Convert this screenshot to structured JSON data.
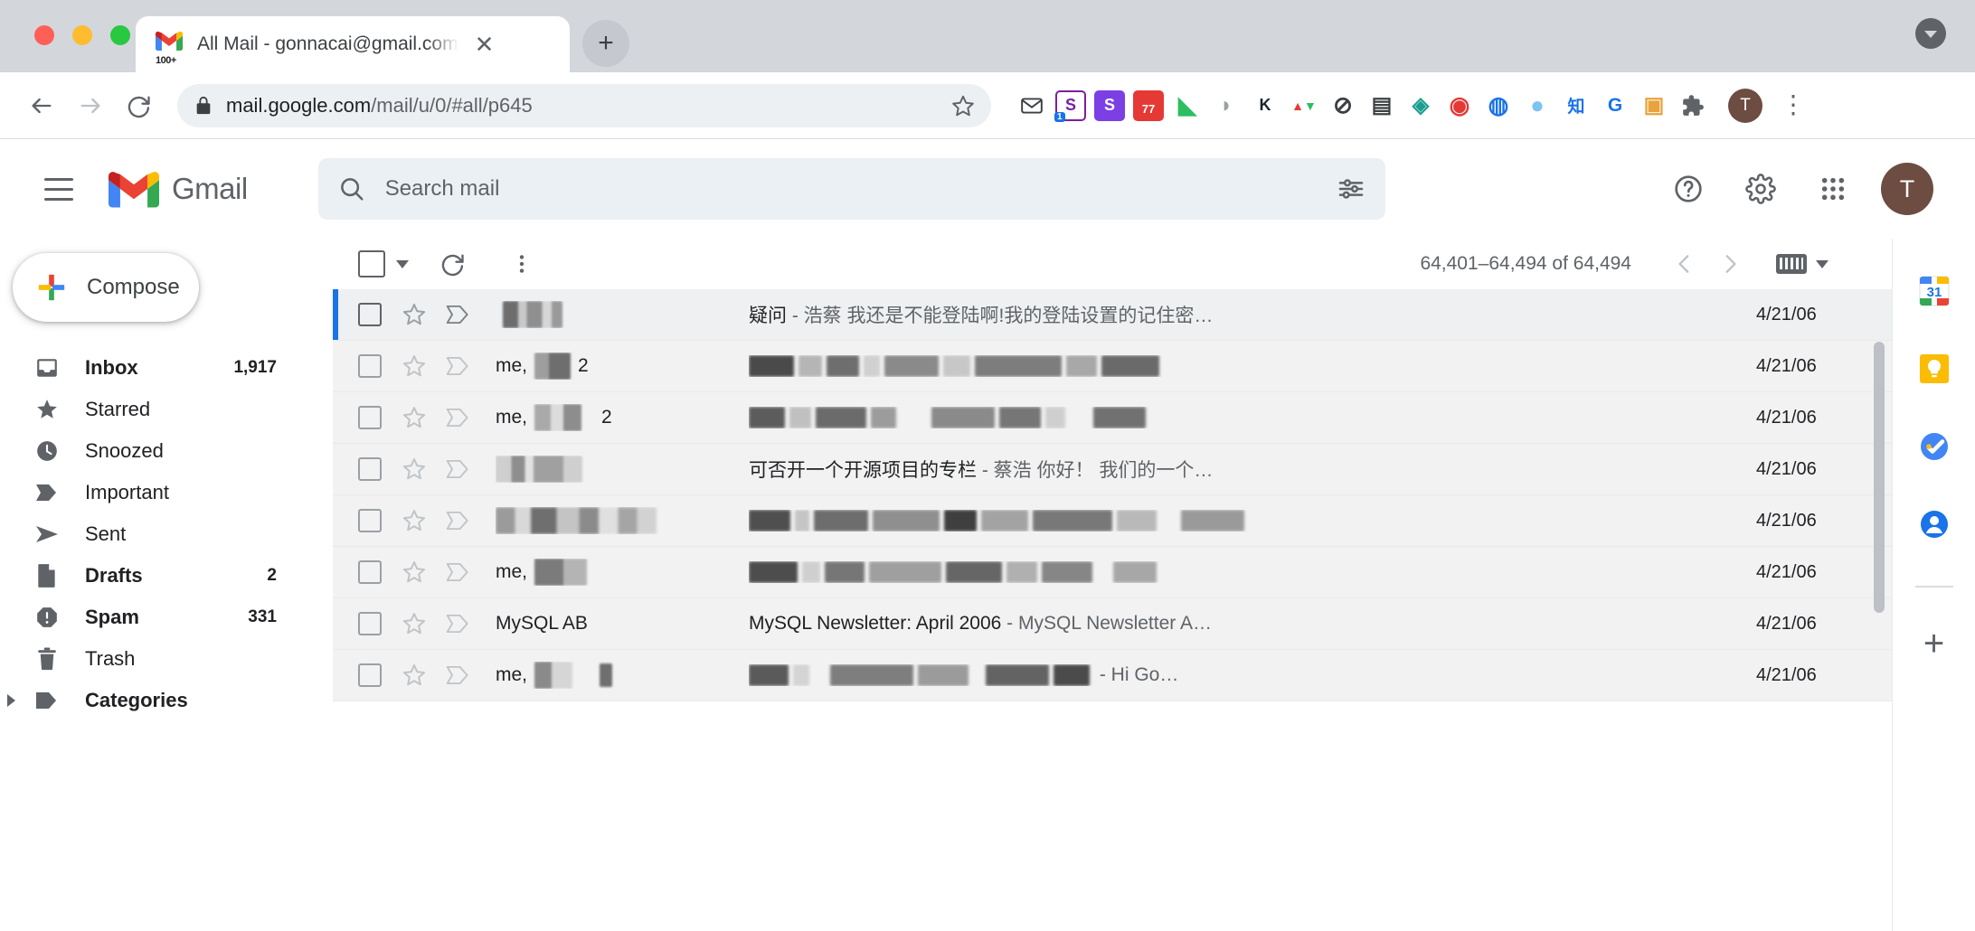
{
  "browser": {
    "tab": {
      "title": "All Mail - gonnacai@gmail.com",
      "favicon_badge": "100+",
      "close_label": "✕",
      "newtab_label": "+"
    },
    "url": {
      "host": "mail.google.com",
      "path": "/mail/u/0/#all/p645",
      "full": "mail.google.com/mail/u/0/#all/p645"
    },
    "nav": {
      "back": "←",
      "forward": "→",
      "reload": "⟳"
    },
    "profile_initial": "T",
    "extensions": [
      {
        "name": "envelope-extension",
        "glyph": "✉",
        "bg": "#ffffff",
        "fg": "#3c4043"
      },
      {
        "name": "s-extension-badged",
        "glyph": "S",
        "bg": "#ffffff",
        "fg": "#7b1fa2",
        "badge": "1"
      },
      {
        "name": "s-extension-purple",
        "glyph": "S",
        "bg": "#7b3fe4",
        "fg": "#ffffff"
      },
      {
        "name": "calendar-extension",
        "glyph": "77",
        "bg": "#e53935",
        "fg": "#ffffff"
      },
      {
        "name": "evernote-extension",
        "glyph": "◣",
        "bg": "#ffffff",
        "fg": "#2dbe60"
      },
      {
        "name": "dropper-extension",
        "glyph": "◗",
        "bg": "#ffffff",
        "fg": "#9aa0a6"
      },
      {
        "name": "k-extension",
        "glyph": "K",
        "bg": "#ffffff",
        "fg": "#1b2430"
      },
      {
        "name": "triangles-extension",
        "glyph": "▲▼",
        "bg": "#ffffff",
        "fg": "#e53935"
      },
      {
        "name": "block-extension",
        "glyph": "⊘",
        "bg": "#ffffff",
        "fg": "#3c4043"
      },
      {
        "name": "document-extension",
        "glyph": "▤",
        "bg": "#ffffff",
        "fg": "#3c4043"
      },
      {
        "name": "diamond-extension",
        "glyph": "◈",
        "bg": "#ffffff",
        "fg": "#1a9e8f"
      },
      {
        "name": "pokeball-extension",
        "glyph": "◉",
        "bg": "#ffffff",
        "fg": "#e53935"
      },
      {
        "name": "globe-extension",
        "glyph": "◍",
        "bg": "#ffffff",
        "fg": "#1a73e8"
      },
      {
        "name": "circle-extension",
        "glyph": "●",
        "bg": "#ffffff",
        "fg": "#7cc3f0"
      },
      {
        "name": "zhihu-extension",
        "glyph": "知",
        "bg": "#ffffff",
        "fg": "#1a73e8"
      },
      {
        "name": "c-extension",
        "glyph": "G",
        "bg": "#ffffff",
        "fg": "#1a73e8"
      },
      {
        "name": "image-download-extension",
        "glyph": "▣",
        "bg": "#ffffff",
        "fg": "#e8a33d"
      },
      {
        "name": "puzzle-extension",
        "glyph": "🧩",
        "bg": "#ffffff",
        "fg": "#5f6368"
      }
    ],
    "menu_label": "⋮"
  },
  "gmail": {
    "logo_word": "Gmail",
    "search": {
      "placeholder": "Search mail",
      "value": ""
    },
    "header_actions": {
      "help": "?",
      "settings": "⚙",
      "apps": "⠿",
      "account_initial": "T"
    },
    "sidebar": {
      "compose_label": "Compose",
      "items": [
        {
          "label": "Inbox",
          "icon": "inbox-icon",
          "count": "1,917",
          "bold": true,
          "expandable": false
        },
        {
          "label": "Starred",
          "icon": "star-icon",
          "count": "",
          "bold": false,
          "expandable": false
        },
        {
          "label": "Snoozed",
          "icon": "clock-icon",
          "count": "",
          "bold": false,
          "expandable": false
        },
        {
          "label": "Important",
          "icon": "important-icon",
          "count": "",
          "bold": false,
          "expandable": false
        },
        {
          "label": "Sent",
          "icon": "send-icon",
          "count": "",
          "bold": false,
          "expandable": false
        },
        {
          "label": "Drafts",
          "icon": "draft-icon",
          "count": "2",
          "bold": true,
          "expandable": false
        },
        {
          "label": "Spam",
          "icon": "spam-icon",
          "count": "331",
          "bold": true,
          "expandable": false
        },
        {
          "label": "Trash",
          "icon": "trash-icon",
          "count": "",
          "bold": false,
          "expandable": false
        },
        {
          "label": "Categories",
          "icon": "label-icon",
          "count": "",
          "bold": true,
          "expandable": true
        }
      ]
    },
    "toolbar": {
      "select_all_label": "Select",
      "refresh_label": "Refresh",
      "more_label": "More",
      "count_text": "64,401–64,494 of 64,494",
      "prev_label": "‹",
      "next_label": "›",
      "keyboard_label": "Input tools"
    },
    "rows": [
      {
        "sender_text": "",
        "sender_redacted": true,
        "subject": "疑问",
        "snippet": " - 浩蔡 我还是不能登陆啊!我的登陆设置的记住密…",
        "subject_redacted": false,
        "date": "4/21/06",
        "selected": true,
        "thread_count": ""
      },
      {
        "sender_text": "me,",
        "sender_redacted": true,
        "subject": "",
        "snippet": "",
        "subject_redacted": true,
        "date": "4/21/06",
        "selected": false,
        "thread_count": "2"
      },
      {
        "sender_text": "me,",
        "sender_redacted": true,
        "subject": "",
        "snippet": "",
        "subject_redacted": true,
        "date": "4/21/06",
        "selected": false,
        "thread_count": "2"
      },
      {
        "sender_text": "",
        "sender_redacted": true,
        "subject": "可否开一个开源项目的专栏",
        "snippet": " - 蔡浩 你好！ 我们的一个…",
        "subject_redacted": false,
        "date": "4/21/06",
        "selected": false,
        "thread_count": ""
      },
      {
        "sender_text": "",
        "sender_redacted": true,
        "subject": "",
        "snippet": "",
        "subject_redacted": true,
        "date": "4/21/06",
        "selected": false,
        "thread_count": ""
      },
      {
        "sender_text": "me,",
        "sender_redacted": true,
        "subject": "",
        "snippet": "",
        "subject_redacted": true,
        "date": "4/21/06",
        "selected": false,
        "thread_count": ""
      },
      {
        "sender_text": "MySQL AB",
        "sender_redacted": false,
        "subject": "MySQL Newsletter: April 2006",
        "snippet": " - MySQL Newsletter A…",
        "subject_redacted": false,
        "date": "4/21/06",
        "selected": false,
        "thread_count": ""
      },
      {
        "sender_text": "me,",
        "sender_redacted": true,
        "subject": "",
        "snippet": " - Hi Go…",
        "subject_redacted": true,
        "date": "4/21/06",
        "selected": false,
        "thread_count": ""
      }
    ],
    "rail": [
      {
        "name": "google-calendar-icon",
        "label": "31"
      },
      {
        "name": "google-keep-icon",
        "label": ""
      },
      {
        "name": "google-tasks-icon",
        "label": ""
      },
      {
        "name": "google-contacts-icon",
        "label": ""
      }
    ],
    "rail_add_label": "+"
  }
}
